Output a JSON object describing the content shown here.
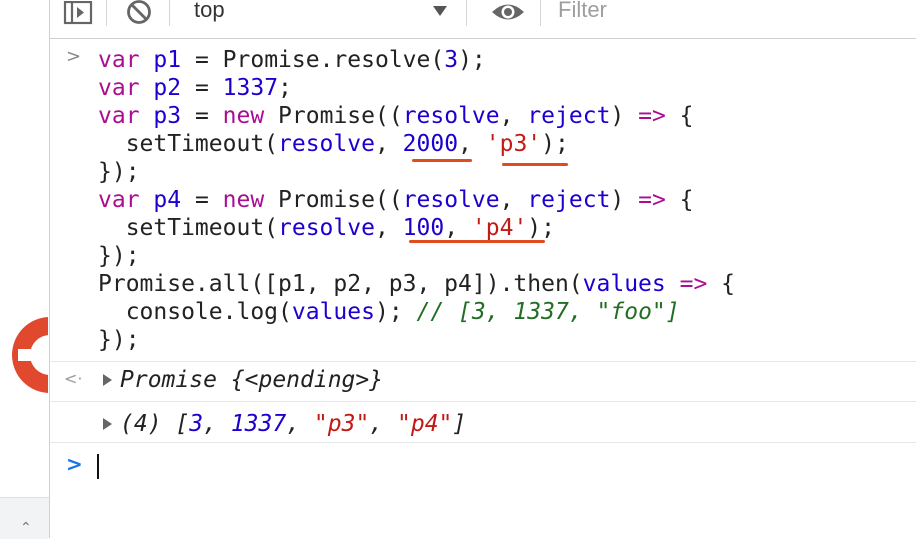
{
  "toolbar": {
    "sidebar_icon": "sidebar-toggle-icon",
    "clear_icon": "clear-console-icon",
    "context": "top",
    "eye_icon": "eye-icon",
    "filter_placeholder": "Filter"
  },
  "code": {
    "line1": {
      "kw": "var",
      "name": "p1",
      "rest1": " = Promise.resolve(",
      "num": "3",
      "rest2": ");"
    },
    "line2": {
      "kw": "var",
      "name": "p2",
      "rest1": " = ",
      "num": "1337",
      "rest2": ";"
    },
    "line3": {
      "kw": "var",
      "name": "p3",
      "eq": " = ",
      "new": "new",
      "ctor": " Promise((",
      "a1": "resolve",
      "comma": ", ",
      "a2": "reject",
      "close": ") ",
      "arrow": "=>",
      "brace": " {"
    },
    "line4": {
      "fn": "  setTimeout(",
      "arg": "resolve",
      "c1": ", ",
      "num": "2000",
      "c2": ", ",
      "str": "'p3'",
      "end": ");"
    },
    "line5": {
      "text": "});"
    },
    "line6": {
      "kw": "var",
      "name": "p4",
      "eq": " = ",
      "new": "new",
      "ctor": " Promise((",
      "a1": "resolve",
      "comma": ", ",
      "a2": "reject",
      "close": ") ",
      "arrow": "=>",
      "brace": " {"
    },
    "line7": {
      "fn": "  setTimeout(",
      "arg": "resolve",
      "c1": ", ",
      "num": "100",
      "c2": ", ",
      "str": "'p4'",
      "end": ");"
    },
    "line8": {
      "text": "});"
    },
    "line9": {
      "pre": "Promise.all([p1, p2, p3, p4]).then(",
      "arg": "values",
      "sp": " ",
      "arrow": "=>",
      "brace": " {"
    },
    "line10": {
      "pre": "  console.log(",
      "arg": "values",
      "post": "); ",
      "comment": "// [3, 1337, \"foo\"]"
    },
    "line11": {
      "text": "});"
    }
  },
  "result1": {
    "label": "Promise ",
    "state": "{<pending>}"
  },
  "result2": {
    "count": "(4) ",
    "open": "[",
    "v1": "3",
    "s1": ", ",
    "v2": "1337",
    "s2": ", ",
    "v3": "\"p3\"",
    "s3": ", ",
    "v4": "\"p4\"",
    "close": "]"
  },
  "gutter": {
    "input_chevron": ">",
    "return_arrow": "<·",
    "prompt_chevron": ">"
  },
  "colors": {
    "accent_underline": "#e04b1f",
    "keyword": "#aa0d91",
    "number": "#1c00cf",
    "string": "#c41a16",
    "comment": "#236e25"
  }
}
